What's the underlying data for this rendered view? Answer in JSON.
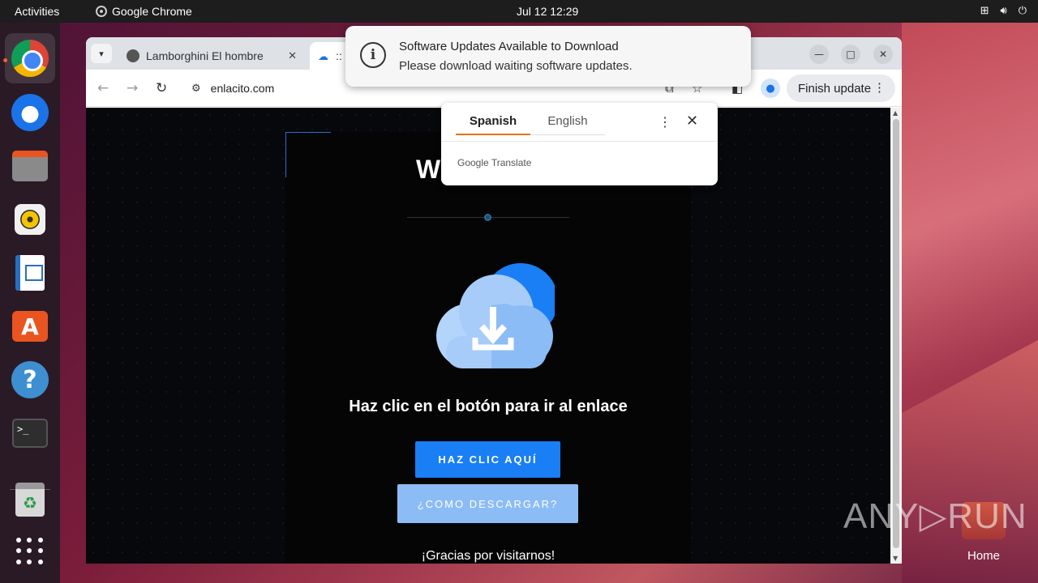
{
  "topbar": {
    "activities": "Activities",
    "app_name": "Google Chrome",
    "clock": "Jul 12  12:29"
  },
  "dock": {
    "items": [
      "chrome-icon",
      "thunderbird-icon",
      "files-icon",
      "rhythmbox-icon",
      "libreoffice-writer-icon",
      "app-center-icon",
      "help-icon",
      "terminal-icon",
      "trash-icon",
      "show-apps-icon"
    ]
  },
  "browser": {
    "tabs": [
      {
        "title": "Lamborghini El hombre",
        "close": "✕"
      },
      {
        "title": "::"
      }
    ],
    "url": "enlacito.com",
    "finish_update": "Finish update"
  },
  "page": {
    "title_fragment": "W",
    "headline": "Haz clic en el botón para ir al enlace",
    "primary_button": "HAZ CLIC AQUÍ",
    "secondary_button": "¿COMO DESCARGAR?",
    "thanks": "¡Gracias por visitarnos!"
  },
  "translate_popup": {
    "source_lang": "Spanish",
    "target_lang": "English",
    "brand": "Google Translate"
  },
  "notification": {
    "title": "Software Updates Available to Download",
    "body": "Please download waiting software updates."
  },
  "desktop": {
    "watermark": "ANY▷RUN",
    "home_label": "Home"
  },
  "colors": {
    "accent_blue": "#1a7ef5",
    "secondary_blue": "#8cbcf5",
    "ubuntu_orange": "#e95420"
  }
}
